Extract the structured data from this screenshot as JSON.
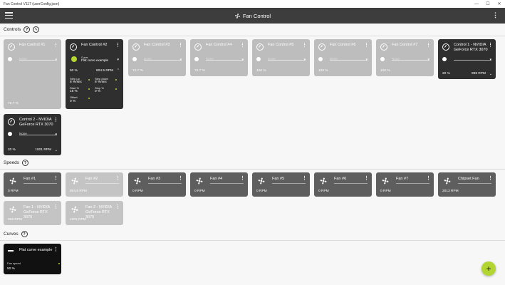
{
  "window": {
    "title": "Fan Control V117 (userConfig.json)",
    "minimize": "—",
    "maximize": "☐",
    "close": "✕"
  },
  "appbar": {
    "title": "Fan Control",
    "more": "⋮"
  },
  "sections": {
    "controls": "Controls",
    "speeds": "Speeds",
    "curves": "Curves",
    "help": "?",
    "tool": "✎"
  },
  "controls": [
    {
      "name": "Fan Control #1",
      "curve": "None",
      "percent": "72.7 %",
      "rpm": "",
      "state": "disabled"
    },
    {
      "name": "Fan Control #2",
      "curve_label": "Curve",
      "curve": "Flat curve example",
      "percent": "50 %",
      "rpm": "804.5 RPM",
      "state": "active",
      "details": {
        "step_up_label": "Step up",
        "step_up": "8 %/sec",
        "step_down_label": "Step down",
        "step_down": "8 %/sec",
        "start_label": "Start %",
        "start": "15 %",
        "stop_label": "Stop %",
        "stop": "0 %",
        "offset_label": "Offset",
        "offset": "0 %"
      }
    },
    {
      "name": "Fan Control #3",
      "curve": "None",
      "percent": "72.7 %",
      "rpm": "",
      "state": "disabled"
    },
    {
      "name": "Fan Control #4",
      "curve": "None",
      "percent": "72.7 %",
      "rpm": "",
      "state": "disabled"
    },
    {
      "name": "Fan Control #5",
      "curve": "None",
      "percent": "100 %",
      "rpm": "",
      "state": "disabled"
    },
    {
      "name": "Fan Control #6",
      "curve": "None",
      "percent": "100 %",
      "rpm": "",
      "state": "disabled"
    },
    {
      "name": "Fan Control #7",
      "curve": "None",
      "percent": "100 %",
      "rpm": "",
      "state": "disabled"
    },
    {
      "name": "Control 1 - NVIDIA GeForce RTX 3070",
      "curve": "",
      "percent": "20 %",
      "rpm": "998 RPM",
      "state": "dark"
    },
    {
      "name": "Control 2 - NVIDIA GeForce RTX 3070",
      "curve": "None",
      "percent": "20 %",
      "rpm": "1001 RPM",
      "state": "dark"
    }
  ],
  "speeds": [
    {
      "name": "Fan #1",
      "rpm": "0 RPM",
      "state": "mid"
    },
    {
      "name": "Fan #2",
      "rpm": "804.5 RPM",
      "state": "disabled"
    },
    {
      "name": "Fan #3",
      "rpm": "0 RPM",
      "state": "mid"
    },
    {
      "name": "Fan #4",
      "rpm": "0 RPM",
      "state": "mid"
    },
    {
      "name": "Fan #5",
      "rpm": "0 RPM",
      "state": "mid"
    },
    {
      "name": "Fan #6",
      "rpm": "0 RPM",
      "state": "mid"
    },
    {
      "name": "Fan #7",
      "rpm": "0 RPM",
      "state": "mid"
    },
    {
      "name": "Chipset Fan",
      "rpm": "2013 RPM",
      "state": "mid"
    },
    {
      "name": "Fan 1 - NVIDIA GeForce RTX 3070",
      "rpm": "998 RPM",
      "state": "disabled"
    },
    {
      "name": "Fan 2 - NVIDIA GeForce RTX 3070",
      "rpm": "1001 RPM",
      "state": "disabled"
    }
  ],
  "curves": [
    {
      "name": "Flat curve example",
      "label": "Fan speed",
      "value": "50 %"
    }
  ],
  "fab": "+",
  "icons": {
    "hamburger": "menu-icon",
    "fan": "fan-icon",
    "gauge": "gauge-icon",
    "help": "help-icon",
    "more": "more-vert-icon",
    "add": "plus-icon"
  }
}
